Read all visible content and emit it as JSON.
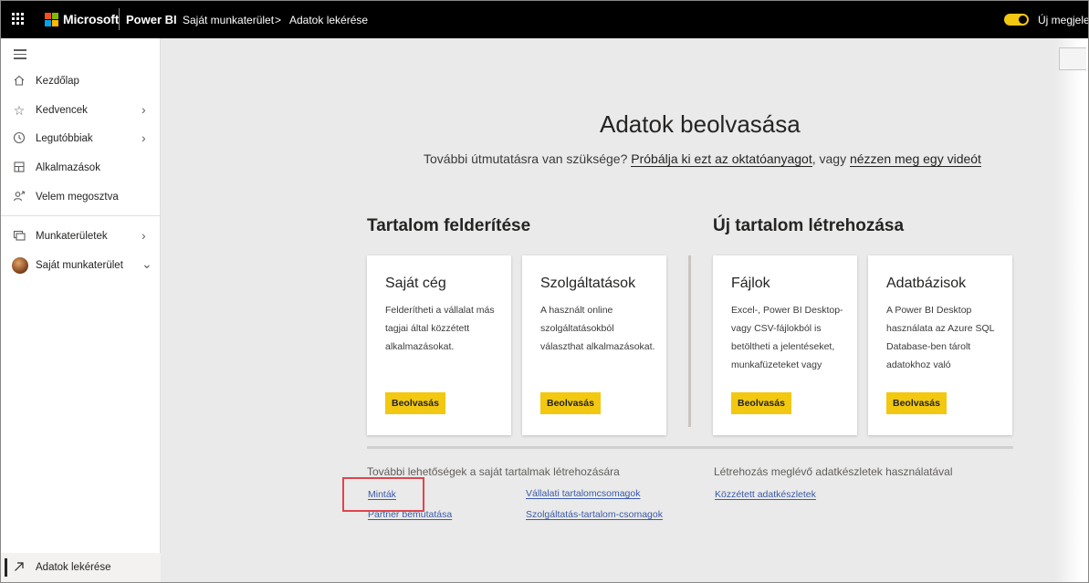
{
  "topbar": {
    "brand": "Microsoft",
    "product": "Power BI",
    "breadcrumb": [
      "Saját munkaterület",
      "Adatok lekérése"
    ],
    "breadcrumb_separator": ">",
    "new_look_label": "Új megjelenés"
  },
  "sidebar": {
    "items": [
      {
        "label": "Kezdőlap",
        "icon": "home-icon"
      },
      {
        "label": "Kedvencek",
        "icon": "star-icon"
      },
      {
        "label": "Legutóbbiak",
        "icon": "clock-icon"
      },
      {
        "label": "Alkalmazások",
        "icon": "apps-icon"
      },
      {
        "label": "Velem megosztva",
        "icon": "shared-icon"
      },
      {
        "label": "Munkaterületek",
        "icon": "workspaces-icon"
      },
      {
        "label": "Saját munkaterület",
        "icon": "avatar"
      }
    ],
    "bottom_label": "Adatok lekérése"
  },
  "main": {
    "title": "Adatok beolvasása",
    "subtitle_prefix": "További útmutatásra van szüksége?",
    "tutorial_link": "Próbálja ki ezt az oktatóanyagot",
    "subtitle_mid": ", vagy",
    "video_link": "nézzen meg egy videót",
    "discover": {
      "title": "Tartalom felderítése",
      "cards": [
        {
          "title": "Saját cég",
          "desc": "Felderítheti a vállalat más tagjai által közzétett alkalmazásokat.",
          "button": "Beolvasás"
        },
        {
          "title": "Szolgáltatások",
          "desc": "A használt online szolgáltatásokból választhat alkalmazásokat.",
          "button": "Beolvasás"
        }
      ]
    },
    "create": {
      "title": "Új tartalom létrehozása",
      "cards": [
        {
          "title": "Fájlok",
          "desc": "Excel-, Power BI Desktop- vagy CSV-fájlokból is betöltheti a jelentéseket, munkafüzeteket vagy",
          "button": "Beolvasás"
        },
        {
          "title": "Adatbázisok",
          "desc": "A Power BI Desktop használata az Azure SQL Database-ben tárolt adatokhoz való",
          "button": "Beolvasás"
        }
      ]
    },
    "more_options": {
      "title": "További lehetőségek a saját tartalmak létrehozására",
      "links": [
        "Minták",
        "Partner bemutatása",
        "Vállalati tartalomcsomagok",
        "Szolgáltatás-tartalom-csomagok"
      ]
    },
    "existing": {
      "title": "Létrehozás meglévő adatkészletek használatával",
      "link": "Közzétett adatkészletek"
    }
  },
  "colors": {
    "topbar_bg": "#000000",
    "accent_yellow": "#f2c811",
    "highlight_red": "#e0454c",
    "link_blue": "#3a5aa8"
  }
}
